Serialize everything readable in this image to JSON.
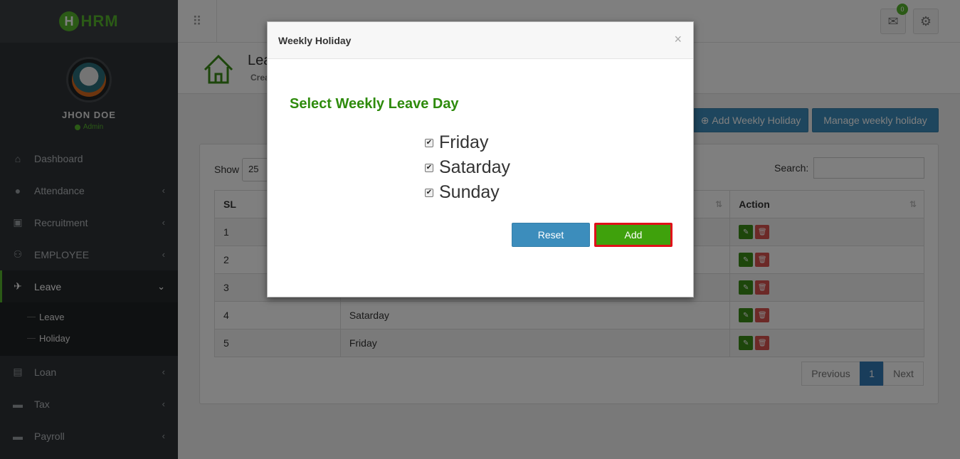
{
  "app": {
    "logo_text": "HRM",
    "logo_letter": "H"
  },
  "user": {
    "name": "JHON DOE",
    "role": "Admin"
  },
  "sidebar": {
    "items": [
      {
        "label": "Dashboard",
        "icon": "home-icon"
      },
      {
        "label": "Attendance",
        "icon": "user-icon"
      },
      {
        "label": "Recruitment",
        "icon": "id-card-icon"
      },
      {
        "label": "EMPLOYEE",
        "icon": "users-icon"
      },
      {
        "label": "Leave",
        "icon": "plane-icon"
      },
      {
        "label": "Loan",
        "icon": "money-icon"
      },
      {
        "label": "Tax",
        "icon": "card-icon"
      },
      {
        "label": "Payroll",
        "icon": "card-icon"
      }
    ],
    "submenu": [
      {
        "label": "Leave"
      },
      {
        "label": "Holiday"
      }
    ]
  },
  "topbar": {
    "mail_count": "0"
  },
  "page_header": {
    "title": "Lea",
    "subtitle": "Crea"
  },
  "actions": {
    "add_weekly": "Add Weekly Holiday",
    "manage_weekly": "Manage weekly holiday"
  },
  "table": {
    "show_label": "Show",
    "page_length": "25",
    "search_label": "Search:",
    "headers": {
      "sl": "SL",
      "action": "Action"
    },
    "rows": [
      {
        "sl": "1",
        "day": ""
      },
      {
        "sl": "2",
        "day": ""
      },
      {
        "sl": "3",
        "day": ""
      },
      {
        "sl": "4",
        "day": "Satarday"
      },
      {
        "sl": "5",
        "day": "Friday"
      }
    ]
  },
  "pagination": {
    "previous": "Previous",
    "current": "1",
    "next": "Next"
  },
  "modal": {
    "title": "Weekly Holiday",
    "close": "×",
    "heading": "Select Weekly Leave Day",
    "days": [
      {
        "label": "Friday",
        "checked": true
      },
      {
        "label": "Satarday",
        "checked": true
      },
      {
        "label": "Sunday",
        "checked": true
      }
    ],
    "reset_label": "Reset",
    "add_label": "Add"
  },
  "colors": {
    "accent_green": "#57b52c",
    "primary_blue": "#3c8dbc",
    "highlight_red": "#e0101a"
  }
}
